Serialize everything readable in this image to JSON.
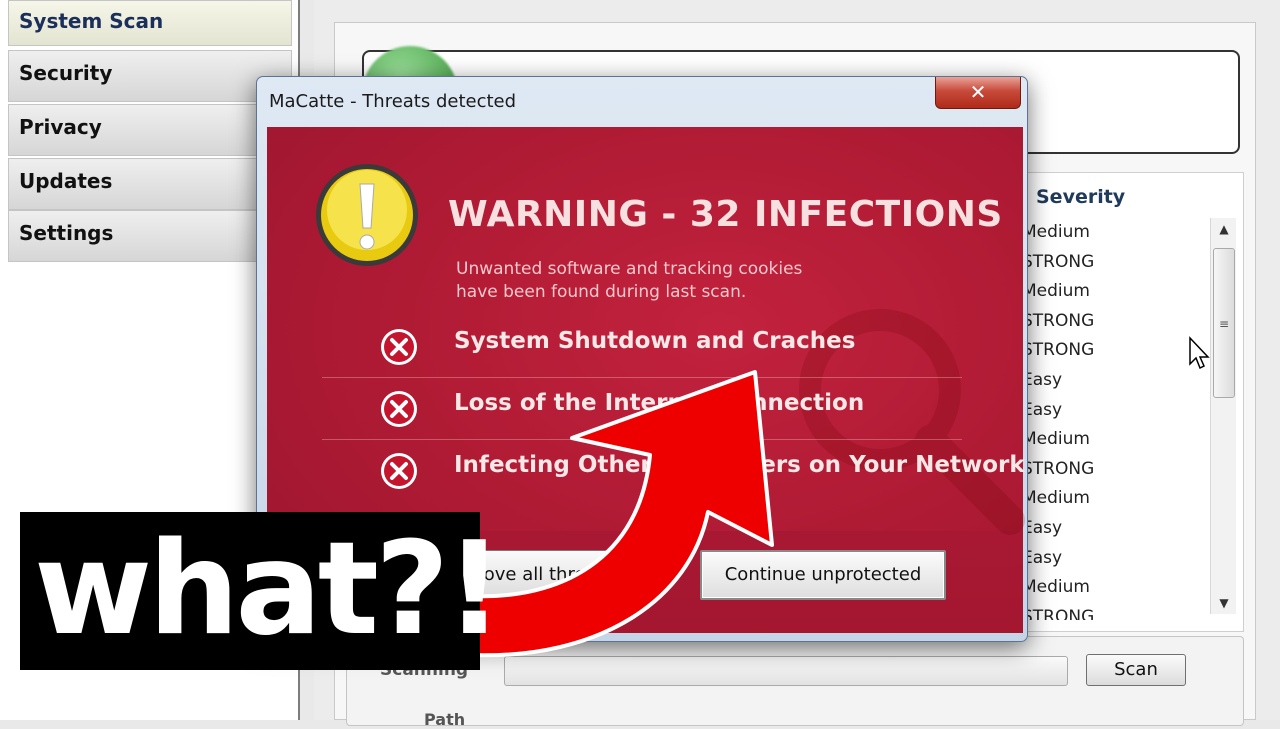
{
  "sidebar": {
    "items": [
      {
        "label": "System Scan"
      },
      {
        "label": "Security"
      },
      {
        "label": "Privacy"
      },
      {
        "label": "Updates"
      },
      {
        "label": "Settings"
      }
    ]
  },
  "main": {
    "severity_header": "Severity",
    "severity_values": [
      "Medium",
      "STRONG",
      "Medium",
      "STRONG",
      "STRONG",
      "Easy",
      "Easy",
      "Medium",
      "STRONG",
      "Medium",
      "Easy",
      "Easy",
      "Medium",
      "STRONG"
    ],
    "scanning_label": "Scanning",
    "scan_button": "Scan",
    "path_label": "Path"
  },
  "dialog": {
    "title": "MaCatte - Threats detected",
    "close_label": "✕",
    "warning_title": "WARNING - 32 INFECTIONS",
    "warning_subtitle_line1": "Unwanted software and tracking cookies",
    "warning_subtitle_line2": "have been found during last scan.",
    "threats": [
      {
        "text": "System Shutdown and Craches"
      },
      {
        "text": "Loss of the Internet Connection"
      },
      {
        "text": "Infecting Other Computers on Your Network"
      }
    ],
    "button_left": "Remove all threats",
    "button_right": "Continue unprotected"
  },
  "overlay": {
    "caption": "what?!"
  },
  "colors": {
    "dialog_red": "#b01c34",
    "arrow_red": "#ee0000",
    "warning_yellow": "#f2d318"
  },
  "icons": [
    "warning-icon",
    "x-circle-icon",
    "close-icon",
    "arrow-up-icon",
    "arrow-down-icon",
    "mouse-cursor-icon",
    "magnifier-icon"
  ]
}
